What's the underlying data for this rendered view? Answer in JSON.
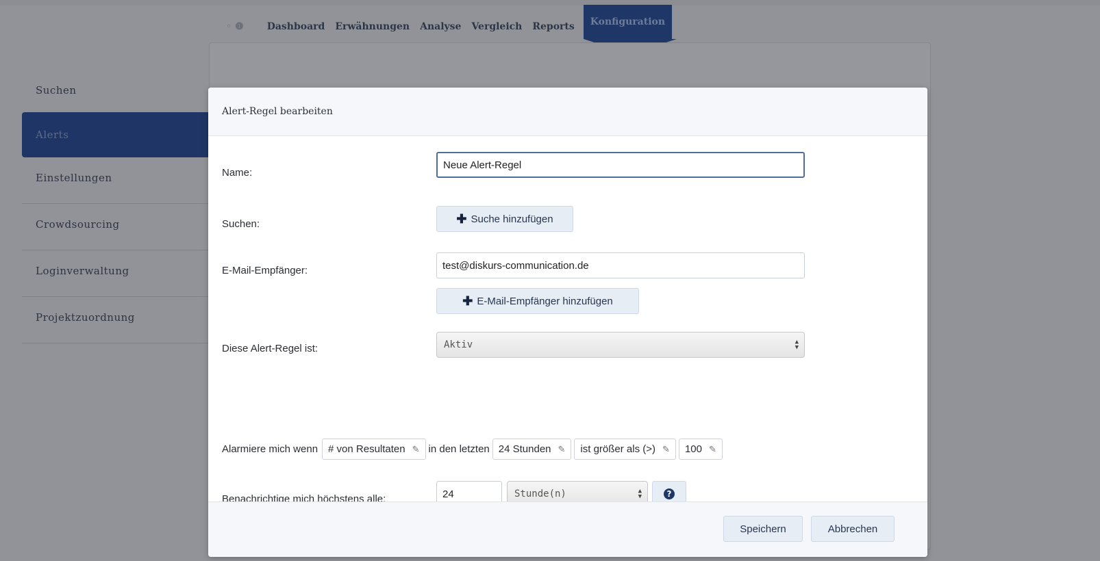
{
  "topnav": {
    "brand_mark": "◦ ❶",
    "items": [
      "Dashboard",
      "Erwähnungen",
      "Analyse",
      "Vergleich",
      "Reports",
      "Konfiguration"
    ]
  },
  "sidebar": {
    "items": [
      "Suchen",
      "Alerts",
      "Einstellungen",
      "Crowdsourcing",
      "Loginverwaltung",
      "Projektzuordnung"
    ]
  },
  "modal": {
    "title": "Alert-Regel bearbeiten",
    "name_label": "Name:",
    "name_value": "Neue Alert-Regel",
    "suchen_label": "Suchen:",
    "add_search_label": "Suche hinzufügen",
    "email_label": "E-Mail-Empfänger:",
    "email_value": "test@diskurs-communication.de",
    "add_email_label": "E-Mail-Empfänger hinzufügen",
    "status_label": "Diese Alert-Regel ist:",
    "status_value": "Aktiv",
    "alarm": {
      "prefix": "Alarmiere mich wenn",
      "metric": "# von Resultaten",
      "mid": "in den letzten",
      "period": "24 Stunden",
      "comparator": "ist größer als (>)",
      "threshold": "100"
    },
    "notify_label": "Benachrichtige mich höchstens alle:",
    "notify_value": "24",
    "notify_unit": "Stunde(n)",
    "help_glyph": "?",
    "save_label": "Speichern",
    "cancel_label": "Abbrechen"
  },
  "colors": {
    "primary": "#1f3766",
    "overlay": "#919398",
    "button_bg": "#e7edf5"
  }
}
